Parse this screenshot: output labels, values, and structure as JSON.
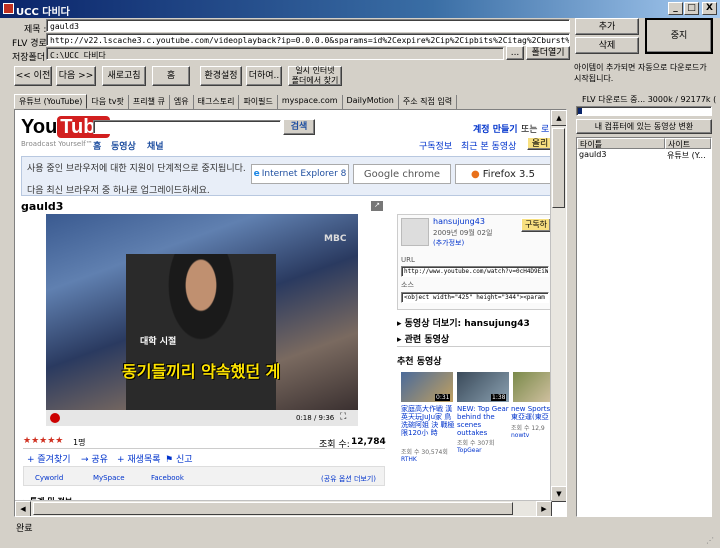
{
  "window": {
    "title": "UCC 다비다",
    "min": "_",
    "max": "□",
    "close": "X"
  },
  "form": {
    "title_label": "제목 :",
    "title_value": "gauld3",
    "flv_label": "FLV 경로:",
    "flv_value": "http://v22.lscache3.c.youtube.com/videoplayback?ip=0.0.0.0&sparams=id%2Cexpire%2Cip%2Cipbits%2Citag%2Cburst%2Cfactor&itag=34&ipbits=0&signature=CFC33",
    "folder_label": "저장폴더:",
    "folder_value": "C:\\UCC 다비다",
    "browse_button": "...",
    "open_folder_button": "폴더열기",
    "add_button": "추가",
    "delete_button": "삭제",
    "stop_button": "중지"
  },
  "toolbar": {
    "back": "<< 이전",
    "forward": "다음 >>",
    "refresh": "새로고침",
    "home": "홈",
    "settings": "환경설정",
    "more": "더하여..",
    "open_ie": "일시 인터넷\n폴더에서 찾기"
  },
  "tabs": [
    "유튜브 (YouTube)",
    "다음 tv팟",
    "프리챌 큐",
    "엠유",
    "태그스토리",
    "파이필드",
    "myspace.com",
    "DailyMotion",
    "주소 직접 입력"
  ],
  "page": {
    "search_button": "검색",
    "broadcast": "Broadcast Yourself™",
    "nav_home": "홈",
    "nav_videos": "동영상",
    "nav_channels": "채널",
    "create_account": "계정 만들기",
    "or": "또는",
    "login": "로",
    "subscriptions": "구독정보",
    "recent_videos": "최근 본 동영상",
    "upload": "올리",
    "notice_line1": "사용 중인 브라우저에 대한 지원이 단계적으로 중지됩니다.",
    "notice_line2": "다음 최신 브라우저 중 하나로 업그레이드하세요.",
    "ie8_label": "Internet Explorer 8",
    "chrome_label": "Google chrome",
    "firefox_label": "Firefox 3.5",
    "video_title": "gauld3",
    "user": "hansujung43",
    "date": "2009년 09월 02일",
    "more_info": "(추가정보)",
    "subscribe": "구독하",
    "url_label": "URL",
    "url_value": "http://www.youtube.com/watch?v=0cH4D9EiW9c",
    "embed_label": "소스",
    "embed_value": "<object width=\"425\" height=\"344\"><param name=\"m",
    "more_from": "동영상 더보기: hansujung43",
    "related": "관련 동영상",
    "recommended": "추천 동영상",
    "time": "0:18 / 9:36",
    "subtitle_top": "대학 시절",
    "subtitle_main": "동기들끼리 약속했던 게",
    "channel_logo": "MBC",
    "stars": "★★★★★",
    "ratings": "1명",
    "views_label": "조회 수:",
    "views_value": "12,784",
    "fav": "즐겨찾기",
    "share": "공유",
    "playlist": "재생목록",
    "flag": "신고",
    "cyworld": "Cyworld",
    "myspace": "MySpace",
    "facebook": "Facebook",
    "share_options": "(공유 옵션 더보기)",
    "stats": "통계 및 정보",
    "thumbs": [
      {
        "time": "0:31",
        "title": "家庭高大作戦 漢英天玩JuJu家 鳥洗碗阿姐 決 戰極限120小 時",
        "views": "조회 수 30,574회",
        "author": "RTHK"
      },
      {
        "time": "1:38",
        "title": "NEW: Top Gear behind the scenes outtakes",
        "views": "조회 수 307회",
        "author": "TopGear"
      },
      {
        "time": "",
        "title": "new Sports 東亞運(東亞",
        "views": "조회 수 12,9",
        "author": "nowtv"
      }
    ]
  },
  "right": {
    "auto_note": "아이템이 추가되면 자동으로 다운로드가 시작됩니다.",
    "progress_label": "FLV 다운로드 중... 3000k / 92177k ( 9 %)",
    "progress_fraction": 0.03,
    "convert_button": "내 컴퓨터에 있는 동영상 변환",
    "col_title": "타이틀",
    "col_site": "사이트",
    "rows": [
      {
        "title": "gauld3",
        "site": "유튜브 (Y..."
      }
    ]
  },
  "status": "완료"
}
